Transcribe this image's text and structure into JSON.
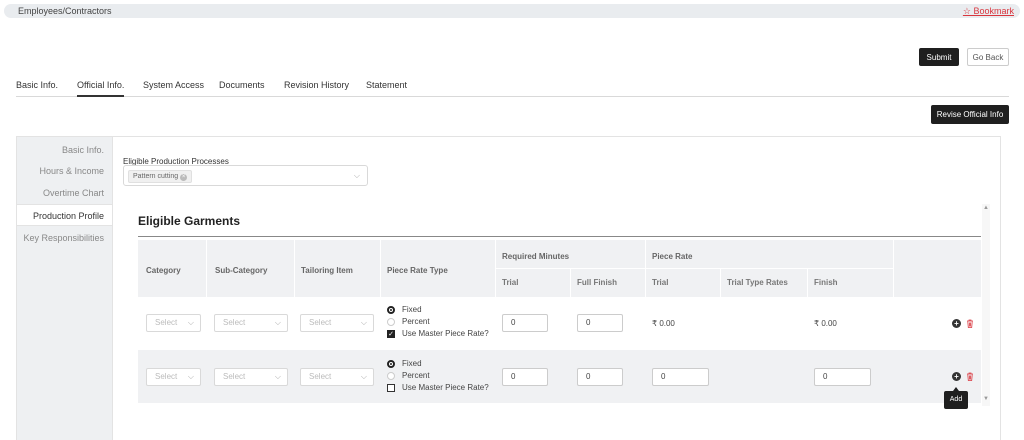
{
  "breadcrumb": "Employees/Contractors",
  "bookmark": "☆ Bookmark",
  "actions": {
    "submit": "Submit",
    "go_back": "Go Back",
    "revise": "Revise Official Info"
  },
  "tabs": [
    "Basic Info.",
    "Official Info.",
    "System Access",
    "Documents",
    "Revision History",
    "Statement"
  ],
  "active_tab": "Official Info.",
  "sidebar": [
    "Basic Info.",
    "Hours & Income",
    "Overtime Chart",
    "Production Profile",
    "Key Responsibilities"
  ],
  "active_sidebar": "Production Profile",
  "eligible_processes": {
    "label": "Eligible Production Processes",
    "selected": [
      "Pattern cutting"
    ]
  },
  "garments": {
    "title": "Eligible Garments",
    "headers": {
      "category": "Category",
      "sub_category": "Sub-Category",
      "tailoring_item": "Tailoring Item",
      "piece_rate_type": "Piece Rate Type",
      "required_minutes": "Required Minutes",
      "piece_rate": "Piece Rate",
      "trial": "Trial",
      "full_finish": "Full Finish",
      "pr_trial": "Trial",
      "trial_type_rates": "Trial Type Rates",
      "finish": "Finish"
    },
    "select_placeholder": "Select",
    "options": {
      "fixed": "Fixed",
      "percent": "Percent",
      "use_master": "Use Master Piece Rate?"
    },
    "rows": [
      {
        "rate_type": "Fixed",
        "use_master": true,
        "req_trial": "0",
        "req_full_finish": "0",
        "pr_trial": "₹ 0.00",
        "pr_finish": "₹ 0.00"
      },
      {
        "rate_type": "Fixed",
        "use_master": false,
        "req_trial": "0",
        "req_full_finish": "0",
        "pr_trial": "0",
        "pr_finish": "0"
      }
    ]
  },
  "tooltip": "Add"
}
